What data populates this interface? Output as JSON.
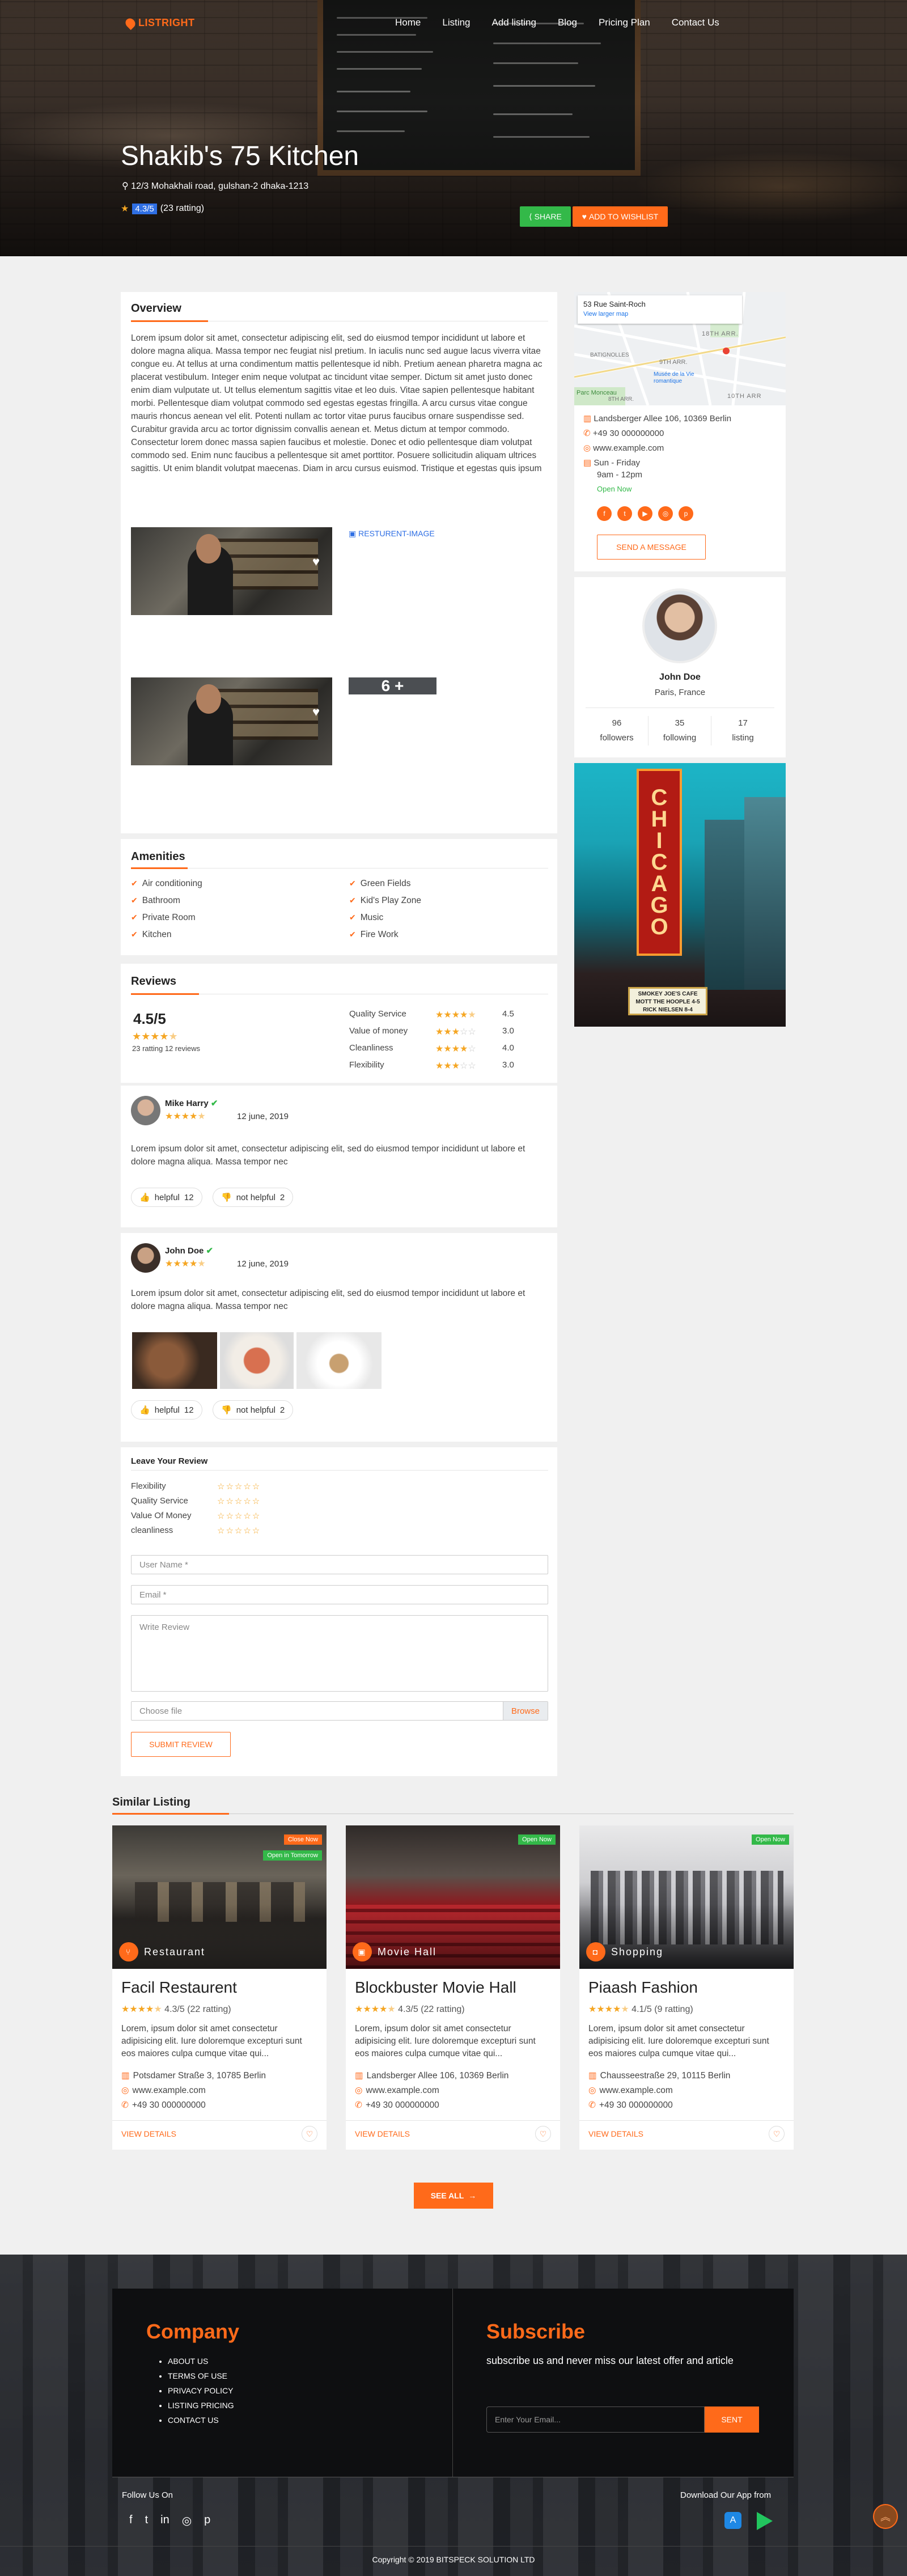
{
  "header": {
    "logo": "LISTRIGHT",
    "nav": [
      "Home",
      "Listing",
      "Add listing",
      "Blog",
      "Pricing Plan",
      "Contact Us"
    ]
  },
  "hero": {
    "title": "Shakib's 75 Kitchen",
    "address": "12/3 Mohakhali road, gulshan-2 dhaka-1213",
    "rating": "4.3/5",
    "rating_count": "(23 ratting)",
    "share_label": "SHARE",
    "wishlist_label": "ADD TO WISHLIST"
  },
  "overview": {
    "title": "Overview",
    "text": "Lorem ipsum dolor sit amet, consectetur adipiscing elit, sed do eiusmod tempor incididunt ut labore et dolore magna aliqua. Massa tempor nec feugiat nisl pretium. In iaculis nunc sed augue lacus viverra vitae congue eu. At tellus at urna condimentum mattis pellentesque id nibh. Pretium aenean pharetra magna ac placerat vestibulum. Integer enim neque volutpat ac tincidunt vitae semper. Dictum sit amet justo donec enim diam vulputate ut. Ut tellus elementum sagittis vitae et leo duis. Vitae sapien pellentesque habitant morbi. Pellentesque diam volutpat commodo sed egestas egestas fringilla. A arcu cursus vitae congue mauris rhoncus aenean vel elit. Potenti nullam ac tortor vitae purus faucibus ornare suspendisse sed. Curabitur gravida arcu ac tortor dignissim convallis aenean et. Metus dictum at tempor commodo. Consectetur lorem donec massa sapien faucibus et molestie. Donec et odio pellentesque diam volutpat commodo sed. Enim nunc faucibus a pellentesque sit amet porttitor. Posuere sollicitudin aliquam ultrices sagittis. Ut enim blandit volutpat maecenas. Diam in arcu cursus euismod. Tristique et egestas quis ipsum",
    "broken_image_alt": "RESTURENT-IMAGE",
    "more_photos": "6 +"
  },
  "amenities": {
    "title": "Amenities",
    "left": [
      "Air conditioning",
      "Bathroom",
      "Private Room",
      "Kitchen"
    ],
    "right": [
      "Green Fields",
      "Kid's Play Zone",
      "Music",
      "Fire Work"
    ]
  },
  "reviews": {
    "title": "Reviews",
    "score": "4.5/5",
    "summary": "23 ratting 12 reviews",
    "criteria": [
      {
        "label": "Quality Service",
        "value": "4.5",
        "stars": 4.5
      },
      {
        "label": "Value of money",
        "value": "3.0",
        "stars": 3
      },
      {
        "label": "Cleanliness",
        "value": "4.0",
        "stars": 4
      },
      {
        "label": "Flexibility",
        "value": "3.0",
        "stars": 3
      }
    ]
  },
  "review_items": [
    {
      "name": "Mike Harry",
      "date": "12 june, 2019",
      "text": "Lorem ipsum dolor sit amet, consectetur adipiscing elit, sed do eiusmod tempor incididunt ut labore et dolore magna aliqua. Massa tempor nec",
      "helpful": "helpful",
      "helpful_count": "12",
      "not_helpful": "not helpful",
      "not_helpful_count": "2"
    },
    {
      "name": "John Doe",
      "date": "12 june, 2019",
      "text": "Lorem ipsum dolor sit amet, consectetur adipiscing elit, sed do eiusmod tempor incididunt ut labore et dolore magna aliqua. Massa tempor nec",
      "helpful": "helpful",
      "helpful_count": "12",
      "not_helpful": "not helpful",
      "not_helpful_count": "2"
    }
  ],
  "leave_review": {
    "title": "Leave Your Review",
    "criteria": [
      "Flexibility",
      "Quality Service",
      "Value Of Money",
      "cleanliness"
    ],
    "username_placeholder": "User Name *",
    "email_placeholder": "Email *",
    "review_placeholder": "Write Review",
    "file_label": "Choose file",
    "browse_label": "Browse",
    "submit_label": "SUBMIT REVIEW"
  },
  "sidebar": {
    "map_place": "53 Rue Saint-Roch",
    "map_link": "View larger map",
    "map_labels": [
      "18TH ARR.",
      "BATIGNOLLES",
      "9TH ARR.",
      "Musée de la Vie romantique",
      "Parc Monceau",
      "10TH ARR",
      "8TH ARR."
    ],
    "address": "Landsberger Allee 106, 10369 Berlin",
    "phone": "+49 30 000000000",
    "website": "www.example.com",
    "days": "Sun - Friday",
    "hours": "9am - 12pm",
    "open": "Open Now",
    "message_label": "SEND A MESSAGE"
  },
  "profile": {
    "name": "John Doe",
    "location": "Paris, France",
    "stats": [
      {
        "value": "96",
        "label": "followers"
      },
      {
        "value": "35",
        "label": "following"
      },
      {
        "value": "17",
        "label": "listing"
      }
    ]
  },
  "ad": {
    "sign": "CHICAGO",
    "marquee": [
      "SMOKEY JOE'S CAFE",
      "MOTT THE HOOPLE 4-5",
      "RICK NIELSEN 8-4"
    ]
  },
  "similar": {
    "title": "Similar Listing",
    "see_all": "SEE ALL",
    "items": [
      {
        "name": "Facil Restaurent",
        "category": "Restaurant",
        "badge": "Close Now",
        "badge2": "Open in Tomorrow",
        "rating": "4.3/5 (22 ratting)",
        "desc": "Lorem, ipsum dolor sit amet consectetur adipisicing elit. Iure doloremque excepturi sunt eos maiores culpa cumque vitae qui...",
        "address": "Potsdamer Straße 3, 10785 Berlin",
        "website": "www.example.com",
        "phone": "+49 30 000000000",
        "view": "VIEW DETAILS"
      },
      {
        "name": "Blockbuster Movie Hall",
        "category": "Movie Hall",
        "badge": "Open Now",
        "rating": "4.3/5 (22 ratting)",
        "desc": "Lorem, ipsum dolor sit amet consectetur adipisicing elit. Iure doloremque excepturi sunt eos maiores culpa cumque vitae qui...",
        "address": "Landsberger Allee 106, 10369 Berlin",
        "website": "www.example.com",
        "phone": "+49 30 000000000",
        "view": "VIEW DETAILS"
      },
      {
        "name": "Piaash Fashion",
        "category": "Shopping",
        "badge": "Open Now",
        "rating": "4.1/5 (9 ratting)",
        "desc": "Lorem, ipsum dolor sit amet consectetur adipisicing elit. Iure doloremque excepturi sunt eos maiores culpa cumque vitae qui...",
        "address": "Chausseestraße 29, 10115 Berlin",
        "website": "www.example.com",
        "phone": "+49 30 000000000",
        "view": "VIEW DETAILS"
      }
    ]
  },
  "footer": {
    "company_title": "Company",
    "links": [
      "ABOUT US",
      "TERMS OF USE",
      "PRIVACY POLICY",
      "LISTING PRICING",
      "CONTACT US"
    ],
    "subscribe_title": "Subscribe",
    "subscribe_text": "subscribe us and never miss our latest offer and article",
    "email_placeholder": "Enter Your Email...",
    "sent_label": "SENT",
    "follow": "Follow Us On",
    "download": "Download Our App from",
    "copyright": "Copyright © 2019 BITSPECK SOLUTION LTD"
  },
  "colors": {
    "accent": "#ff6a1a",
    "green": "#33b949",
    "star": "#f5a623",
    "blue": "#2f6fe4"
  }
}
